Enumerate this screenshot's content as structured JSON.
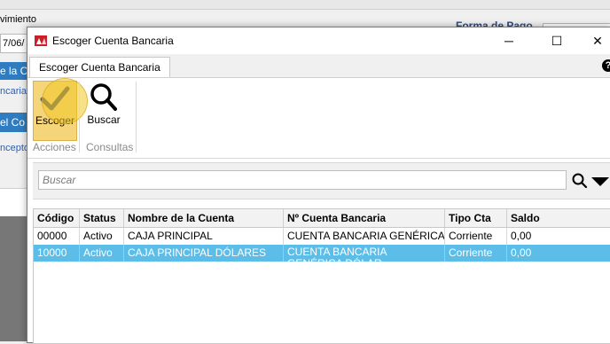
{
  "background": {
    "movement_label": "vimiento",
    "date_fragment": "7/06/",
    "blue_field_1": "e la C",
    "text_1": "ncaria",
    "blue_field_2": "el Co",
    "text_2": "ncepto",
    "forma_label": "Forma de Pago"
  },
  "dialog": {
    "title": "Escoger Cuenta Bancaria",
    "window_buttons": {
      "minimize": "─",
      "maximize": "☐",
      "close": "✕"
    },
    "tab_label": "Escoger Cuenta Bancaria",
    "help": "?",
    "ribbon": {
      "escoger_label": "Escoger",
      "buscar_label": "Buscar",
      "group_acciones": "Acciones",
      "group_consultas": "Consultas"
    },
    "search": {
      "placeholder": "Buscar"
    }
  },
  "table": {
    "columns": [
      "Código",
      "Status",
      "Nombre de la Cuenta",
      "Nº Cuenta Bancaria",
      "Tipo Cta",
      "Saldo"
    ],
    "rows": [
      {
        "codigo": "00000",
        "status": "Activo",
        "nombre": "CAJA PRINCIPAL",
        "cuenta": "CUENTA BANCARIA GENÉRICA",
        "tipo": "Corriente",
        "saldo": "0,00"
      },
      {
        "codigo": "10000",
        "status": "Activo",
        "nombre": "CAJA PRINCIPAL DÓLARES",
        "cuenta": "CUENTA BANCARIA GENÉRICA DÓLAR",
        "tipo": "Corriente",
        "saldo": "0,00"
      }
    ]
  },
  "colors": {
    "selected_row": "#5bbde8",
    "escoger_button": "#f5d57a",
    "highlight": "#f0c828",
    "background_blue": "#2f7cc1"
  },
  "icons": {
    "app": "app-logo-icon",
    "escoger": "checkmark-icon",
    "buscar": "magnifier-icon",
    "search": "search-icon",
    "dropdown": "triangle-down-icon"
  }
}
